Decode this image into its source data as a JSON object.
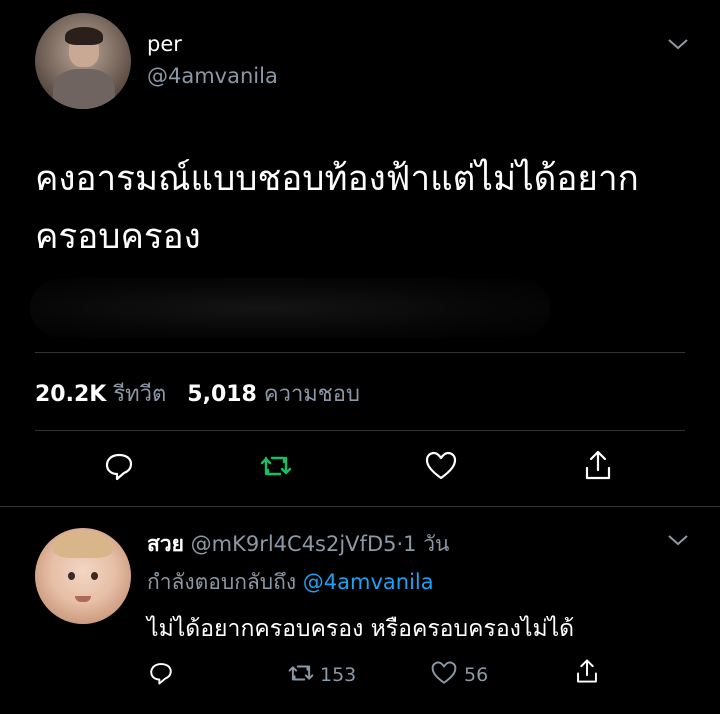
{
  "tweet": {
    "author_name": "per",
    "author_handle": "@4amvanila",
    "text_line1": "คงอารมณ์แบบชอบท้องฟ้าแต่ไม่ได้อยาก",
    "text_line2": "ครอบครอง",
    "retweet_count": "20.2K",
    "retweet_label": "รีทวีต",
    "like_count": "5,018",
    "like_label": "ความชอบ"
  },
  "reply": {
    "author_name": "สวย",
    "author_handle": "@mK9rl4C4s2jVfD5",
    "separator": "·",
    "time": "1 วัน",
    "replying_label": "กำลังตอบกลับถึง",
    "replying_to": "@4amvanila",
    "text": "ไม่ได้อยากครอบครอง หรือครอบครองไม่ได้",
    "retweet_count": "153",
    "like_count": "56"
  },
  "icons": {
    "reply": "reply-bubble-icon",
    "retweet": "retweet-icon",
    "like": "heart-icon",
    "share": "share-icon",
    "menu": "chevron-down-icon"
  },
  "colors": {
    "background": "#000000",
    "secondary_text": "#8b98a5",
    "link": "#1da1f2",
    "retweet_active": "#17bf63",
    "divider": "#2f3336"
  }
}
